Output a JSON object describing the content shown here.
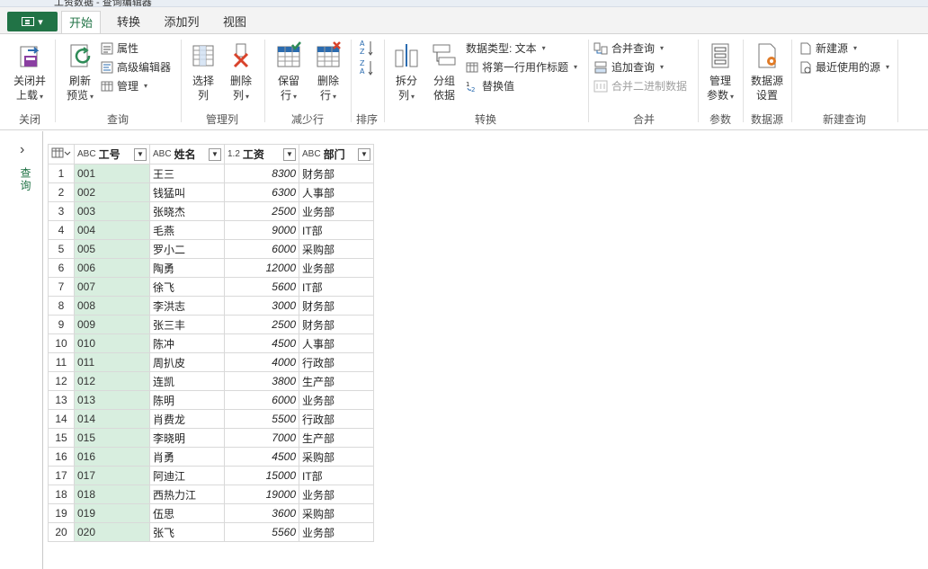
{
  "window": {
    "title": "工资数据 - 查询编辑器"
  },
  "tabs": [
    {
      "label": "开始"
    },
    {
      "label": "转换"
    },
    {
      "label": "添加列"
    },
    {
      "label": "视图"
    }
  ],
  "ribbon": {
    "close": {
      "btn1": "关闭并",
      "btn2": "上载",
      "group": "关闭"
    },
    "query": {
      "refresh1": "刷新",
      "refresh2": "预览",
      "properties": "属性",
      "advanced": "高级编辑器",
      "manage": "管理",
      "group": "查询"
    },
    "columns": {
      "select1": "选择",
      "select2": "列",
      "delete1": "删除",
      "delete2": "列",
      "group": "管理列"
    },
    "rows": {
      "keep1": "保留",
      "keep2": "行",
      "remove1": "删除",
      "remove2": "行",
      "group": "减少行"
    },
    "sort": {
      "group": "排序"
    },
    "transform": {
      "split1": "拆分",
      "split2": "列",
      "groupby1": "分组",
      "groupby2": "依据",
      "datatype": "数据类型: 文本",
      "firstrow": "将第一行用作标题",
      "replace": "替换值",
      "group": "转换"
    },
    "combine": {
      "merge": "合并查询",
      "append": "追加查询",
      "binary": "合并二进制数据",
      "group": "合并"
    },
    "params": {
      "manage1": "管理",
      "manage2": "参数",
      "group": "参数"
    },
    "datasource": {
      "settings1": "数据源",
      "settings2": "设置",
      "group": "数据源"
    },
    "newquery": {
      "newsource": "新建源",
      "recent": "最近使用的源",
      "group": "新建查询"
    }
  },
  "leftpane": {
    "label": "查询"
  },
  "table": {
    "columns": [
      {
        "type": "ABC",
        "name": "工号"
      },
      {
        "type": "ABC",
        "name": "姓名"
      },
      {
        "type": "1.2",
        "name": "工资"
      },
      {
        "type": "ABC",
        "name": "部门"
      }
    ],
    "rows": [
      [
        "1",
        "001",
        "王三",
        "8300",
        "财务部"
      ],
      [
        "2",
        "002",
        "钱猛叫",
        "6300",
        "人事部"
      ],
      [
        "3",
        "003",
        "张晓杰",
        "2500",
        "业务部"
      ],
      [
        "4",
        "004",
        "毛燕",
        "9000",
        "IT部"
      ],
      [
        "5",
        "005",
        "罗小二",
        "6000",
        "采购部"
      ],
      [
        "6",
        "006",
        "陶勇",
        "12000",
        "业务部"
      ],
      [
        "7",
        "007",
        "徐飞",
        "5600",
        "IT部"
      ],
      [
        "8",
        "008",
        "李洪志",
        "3000",
        "财务部"
      ],
      [
        "9",
        "009",
        "张三丰",
        "2500",
        "财务部"
      ],
      [
        "10",
        "010",
        "陈冲",
        "4500",
        "人事部"
      ],
      [
        "11",
        "011",
        "周扒皮",
        "4000",
        "行政部"
      ],
      [
        "12",
        "012",
        "连凯",
        "3800",
        "生产部"
      ],
      [
        "13",
        "013",
        "陈明",
        "6000",
        "业务部"
      ],
      [
        "14",
        "014",
        "肖费龙",
        "5500",
        "行政部"
      ],
      [
        "15",
        "015",
        "李晓明",
        "7000",
        "生产部"
      ],
      [
        "16",
        "016",
        "肖勇",
        "4500",
        "采购部"
      ],
      [
        "17",
        "017",
        "阿迪江",
        "15000",
        "IT部"
      ],
      [
        "18",
        "018",
        "西热力江",
        "19000",
        "业务部"
      ],
      [
        "19",
        "019",
        "伍思",
        "3600",
        "采购部"
      ],
      [
        "20",
        "020",
        "张飞",
        "5560",
        "业务部"
      ]
    ]
  }
}
